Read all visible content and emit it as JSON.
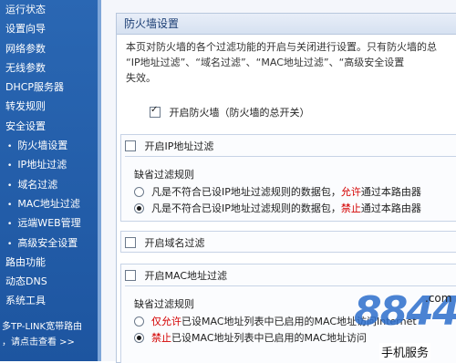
{
  "sidebar": {
    "items": [
      {
        "label": "运行状态",
        "sub": false
      },
      {
        "label": "设置向导",
        "sub": false
      },
      {
        "label": "网络参数",
        "sub": false
      },
      {
        "label": "无线参数",
        "sub": false
      },
      {
        "label": "DHCP服务器",
        "sub": false
      },
      {
        "label": "转发规则",
        "sub": false
      },
      {
        "label": "安全设置",
        "sub": false
      },
      {
        "label": "防火墙设置",
        "sub": true
      },
      {
        "label": "IP地址过滤",
        "sub": true
      },
      {
        "label": "域名过滤",
        "sub": true
      },
      {
        "label": "MAC地址过滤",
        "sub": true
      },
      {
        "label": "远端WEB管理",
        "sub": true
      },
      {
        "label": "高级安全设置",
        "sub": true
      },
      {
        "label": "路由功能",
        "sub": false
      },
      {
        "label": "动态DNS",
        "sub": false
      },
      {
        "label": "系统工具",
        "sub": false
      }
    ],
    "footer_line1": "多TP-LINK宽带路由",
    "footer_line2": "，请点击查看 >>"
  },
  "panel": {
    "title": "防火墙设置",
    "intro_line1": "本页对防火墙的各个过滤功能的开启与关闭进行设置。只有防火墙的总",
    "intro_line2": "“IP地址过滤”、“域名过滤”、“MAC地址过滤”、“高级安全设置",
    "intro_line3": "失效。",
    "firewall_toggle": {
      "label": "开启防火墙（防火墙的总开关）",
      "checked": true
    },
    "ip_filter": {
      "label": "开启IP地址过滤",
      "checked": false,
      "default_rule_label": "缺省过滤规则",
      "option1_prefix": "凡是不符合已设IP地址过滤规则的数据包，",
      "option1_keyword": "允许",
      "option1_suffix": "通过本路由器",
      "option2_prefix": "凡是不符合已设IP地址过滤规则的数据包，",
      "option2_keyword": "禁止",
      "option2_suffix": "通过本路由器",
      "selected": 2
    },
    "domain_filter": {
      "label": "开启域名过滤",
      "checked": false
    },
    "mac_filter": {
      "label": "开启MAC地址过滤",
      "checked": false,
      "default_rule_label": "缺省过滤规则",
      "option1_keyword": "仅允许",
      "option1_suffix": "已设MAC地址列表中已启用的MAC地址访问Internet",
      "option2_keyword": "禁止",
      "option2_suffix": "已设MAC地址列表中已启用的MAC地址访问",
      "selected": 2
    }
  },
  "watermark": {
    "digits": "8844",
    "domain_suffix": ".com",
    "text": "手机服务"
  },
  "colors": {
    "sidebar_bg": "#1f5aa6",
    "panel_header": "#dfe7f4",
    "warning_red": "#d40000"
  }
}
